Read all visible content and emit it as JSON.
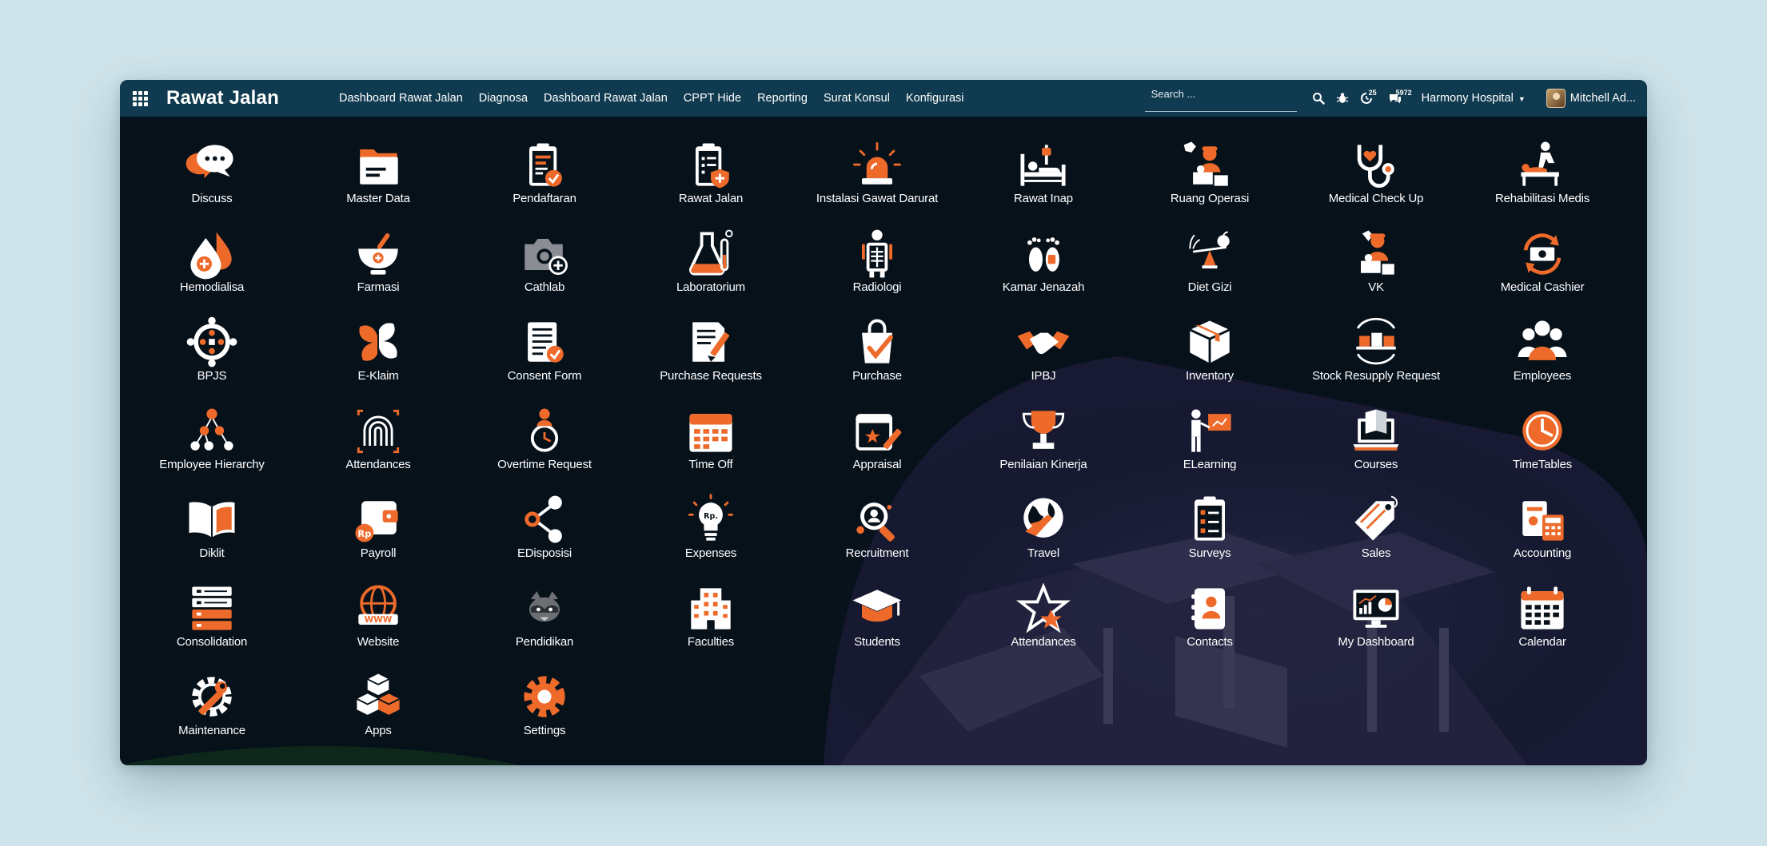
{
  "window": {
    "background": "#06111a",
    "bar_color": "#0f3a4f",
    "accent": "#ee6a2a"
  },
  "header": {
    "app_title": "Rawat Jalan",
    "menu": [
      "Dashboard Rawat Jalan",
      "Diagnosa",
      "Dashboard Rawat Jalan",
      "CPPT Hide",
      "Reporting",
      "Surat Konsul",
      "Konfigurasi"
    ],
    "search_placeholder": "Search ...",
    "activity_count": "25",
    "message_count": "5972",
    "company": "Harmony Hospital",
    "user": "Mitchell Ad..."
  },
  "apps": [
    {
      "label": "Discuss",
      "icon": "chat-icon"
    },
    {
      "label": "Master Data",
      "icon": "folder-icon"
    },
    {
      "label": "Pendaftaran",
      "icon": "clipboard-check-icon"
    },
    {
      "label": "Rawat Jalan",
      "icon": "clipboard-shield-icon"
    },
    {
      "label": "Instalasi Gawat Darurat",
      "icon": "siren-icon"
    },
    {
      "label": "Rawat Inap",
      "icon": "hospital-bed-icon"
    },
    {
      "label": "Ruang Operasi",
      "icon": "surgeon-icon"
    },
    {
      "label": "Medical Check Up",
      "icon": "stethoscope-icon"
    },
    {
      "label": "Rehabilitasi Medis",
      "icon": "physiotherapy-icon"
    },
    {
      "label": "Hemodialisa",
      "icon": "blood-drop-icon"
    },
    {
      "label": "Farmasi",
      "icon": "mortar-pestle-icon"
    },
    {
      "label": "Cathlab",
      "icon": "camera-plus-icon"
    },
    {
      "label": "Laboratorium",
      "icon": "flask-icon"
    },
    {
      "label": "Radiologi",
      "icon": "xray-icon"
    },
    {
      "label": "Kamar Jenazah",
      "icon": "footprints-icon"
    },
    {
      "label": "Diet Gizi",
      "icon": "nutrition-scale-icon"
    },
    {
      "label": "VK",
      "icon": "doctor-icon"
    },
    {
      "label": "Medical Cashier",
      "icon": "money-exchange-icon"
    },
    {
      "label": "BPJS",
      "icon": "bpjs-logo-icon"
    },
    {
      "label": "E-Klaim",
      "icon": "petal-logo-icon"
    },
    {
      "label": "Consent Form",
      "icon": "document-check-icon"
    },
    {
      "label": "Purchase Requests",
      "icon": "document-pen-icon"
    },
    {
      "label": "Purchase",
      "icon": "shopping-bag-check-icon"
    },
    {
      "label": "IPBJ",
      "icon": "handshake-icon"
    },
    {
      "label": "Inventory",
      "icon": "box-icon"
    },
    {
      "label": "Stock Resupply Request",
      "icon": "truck-boxes-icon"
    },
    {
      "label": "Employees",
      "icon": "people-icon"
    },
    {
      "label": "Employee Hierarchy",
      "icon": "org-chart-icon"
    },
    {
      "label": "Attendances",
      "icon": "fingerprint-icon"
    },
    {
      "label": "Overtime Request",
      "icon": "person-clock-icon"
    },
    {
      "label": "Time Off",
      "icon": "calendar-grid-icon"
    },
    {
      "label": "Appraisal",
      "icon": "calendar-pen-icon"
    },
    {
      "label": "Penilaian Kinerja",
      "icon": "trophy-icon"
    },
    {
      "label": "ELearning",
      "icon": "teacher-board-icon"
    },
    {
      "label": "Courses",
      "icon": "laptop-book-icon"
    },
    {
      "label": "TimeTables",
      "icon": "clock-icon"
    },
    {
      "label": "Diklit",
      "icon": "open-book-icon"
    },
    {
      "label": "Payroll",
      "icon": "wallet-icon"
    },
    {
      "label": "EDisposisi",
      "icon": "share-icon"
    },
    {
      "label": "Expenses",
      "icon": "lightbulb-icon"
    },
    {
      "label": "Recruitment",
      "icon": "search-person-icon"
    },
    {
      "label": "Travel",
      "icon": "globe-plane-icon"
    },
    {
      "label": "Surveys",
      "icon": "survey-clipboard-icon"
    },
    {
      "label": "Sales",
      "icon": "price-tag-icon"
    },
    {
      "label": "Accounting",
      "icon": "calculator-icon"
    },
    {
      "label": "Consolidation",
      "icon": "server-icon"
    },
    {
      "label": "Website",
      "icon": "www-globe-icon"
    },
    {
      "label": "Pendidikan",
      "icon": "raccoon-icon"
    },
    {
      "label": "Faculties",
      "icon": "building-icon"
    },
    {
      "label": "Students",
      "icon": "graduation-cap-icon"
    },
    {
      "label": "Attendances",
      "icon": "star-icon"
    },
    {
      "label": "Contacts",
      "icon": "contact-book-icon"
    },
    {
      "label": "My Dashboard",
      "icon": "monitor-chart-icon"
    },
    {
      "label": "Calendar",
      "icon": "calendar-icon"
    },
    {
      "label": "Maintenance",
      "icon": "gear-wrench-icon"
    },
    {
      "label": "Apps",
      "icon": "cubes-icon"
    },
    {
      "label": "Settings",
      "icon": "gear-icon"
    }
  ]
}
